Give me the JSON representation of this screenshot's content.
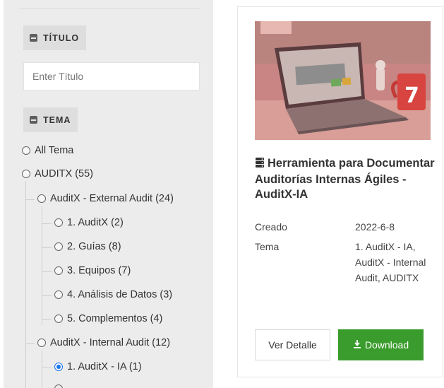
{
  "filters": {
    "titulo": {
      "header": "TÍTULO",
      "placeholder": "Enter Título",
      "value": ""
    },
    "tema": {
      "header": "TEMA",
      "options": [
        {
          "label": "All Tema",
          "checked": false
        },
        {
          "label": "AUDITX (55)",
          "checked": false
        },
        {
          "label": "AuditX - External Audit (24)",
          "checked": false
        },
        {
          "label": "1. AuditX (2)",
          "checked": false
        },
        {
          "label": "2. Guías (8)",
          "checked": false
        },
        {
          "label": "3. Equipos (7)",
          "checked": false
        },
        {
          "label": "4. Análisis de Datos (3)",
          "checked": false
        },
        {
          "label": "5. Complementos (4)",
          "checked": false
        },
        {
          "label": "AuditX - Internal Audit (12)",
          "checked": false
        },
        {
          "label": "1. AuditX - IA (1)",
          "checked": true
        }
      ]
    }
  },
  "card": {
    "title": "Herramienta para Documentar Auditorías Internas Ágiles - AuditX-IA",
    "title_icon": "database-icon",
    "meta": {
      "creado_label": "Creado",
      "creado_value": "2022-6-8",
      "tema_label": "Tema",
      "tema_value": "1. AuditX - IA, AuditX - Internal Audit, AUDITX"
    },
    "detail_label": "Ver Detalle",
    "download_label": "Download",
    "download_icon": "download-icon",
    "download_color": "#3a9c2c",
    "image_mug_number": "7"
  }
}
